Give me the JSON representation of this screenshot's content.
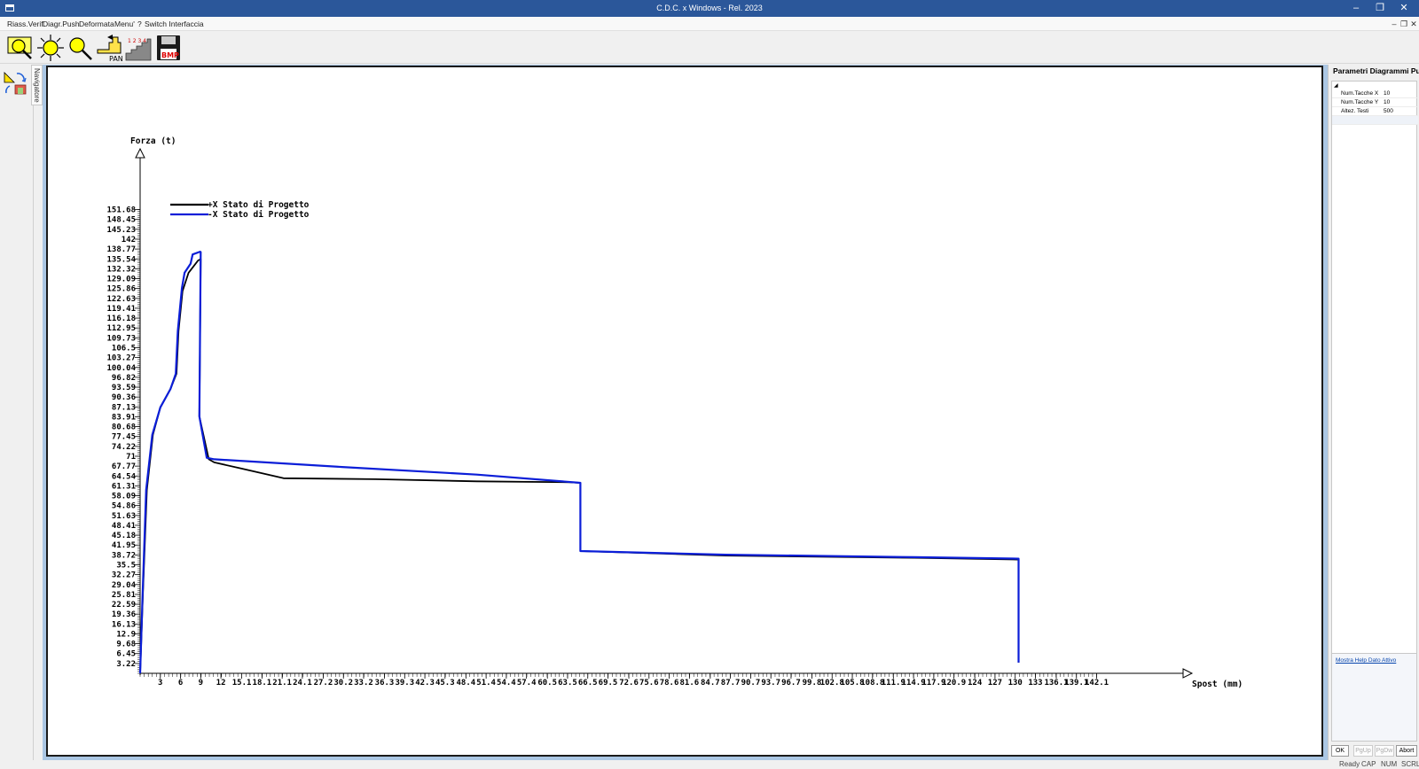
{
  "window": {
    "title": "C.D.C. x Windows - Rel. 2023"
  },
  "menu": {
    "items": [
      "Riass.Verif.",
      "Diagr.Push",
      "Deformata",
      "Menu'",
      "?",
      "Switch Interfaccia"
    ]
  },
  "toolbar": {
    "pan_label": "PAN",
    "bmp_label": "BMP"
  },
  "navigator": {
    "tab_label": "Navigatore"
  },
  "right_panel": {
    "title": "Parametri Diagrammi Pu...",
    "properties": [
      {
        "name": "Num.Tacche X",
        "value": "10"
      },
      {
        "name": "Num.Tacche Y",
        "value": "10"
      },
      {
        "name": "Altez. Testi",
        "value": "500"
      }
    ],
    "help_link": "Mostra Help Dato Attivo",
    "buttons": {
      "ok": "OK",
      "pgup": "PgUp",
      "pgdw": "PgDw",
      "abort": "Abort"
    }
  },
  "status": {
    "ready": "Ready",
    "cap": "CAP",
    "num": "NUM",
    "scrl": "SCRL"
  },
  "chart_data": {
    "type": "line",
    "ylabel": "Forza (t)",
    "xlabel": "Spost (mm)",
    "y_ticks": [
      "3.22",
      "6.45",
      "9.68",
      "12.9",
      "16.13",
      "19.36",
      "22.59",
      "25.81",
      "29.04",
      "32.27",
      "35.5",
      "38.72",
      "41.95",
      "45.18",
      "48.41",
      "51.63",
      "54.86",
      "58.09",
      "61.31",
      "64.54",
      "67.77",
      "71",
      "74.22",
      "77.45",
      "80.68",
      "83.91",
      "87.13",
      "90.36",
      "93.59",
      "96.82",
      "100.04",
      "103.27",
      "106.5",
      "109.73",
      "112.95",
      "116.18",
      "119.41",
      "122.63",
      "125.86",
      "129.09",
      "132.32",
      "135.54",
      "138.77",
      "142",
      "145.23",
      "148.45",
      "151.68"
    ],
    "x_ticks": [
      "3",
      "6",
      "9",
      "12",
      "15.1",
      "18.1",
      "21.1",
      "24.1",
      "27.2",
      "30.2",
      "33.2",
      "36.3",
      "39.3",
      "42.3",
      "45.3",
      "48.4",
      "51.4",
      "54.4",
      "57.4",
      "60.5",
      "63.5",
      "66.5",
      "69.5",
      "72.6",
      "75.6",
      "78.6",
      "81.6",
      "84.7",
      "87.7",
      "90.7",
      "93.7",
      "96.7",
      "99.8",
      "102.8",
      "105.8",
      "108.8",
      "111.9",
      "114.9",
      "117.9",
      "120.9",
      "124",
      "127",
      "130",
      "133",
      "136.1",
      "139.1",
      "142.1"
    ],
    "y_range": [
      0,
      151.68
    ],
    "x_range": [
      0,
      142.1
    ],
    "grid": false,
    "legend_position": "top-left",
    "series": [
      {
        "name": "+X Stato di Progetto",
        "color": "#000000",
        "points": [
          [
            0,
            0
          ],
          [
            0.4,
            25
          ],
          [
            1,
            60
          ],
          [
            1.9,
            78
          ],
          [
            3,
            87
          ],
          [
            4.5,
            93
          ],
          [
            5.4,
            98
          ],
          [
            5.7,
            112
          ],
          [
            6.3,
            125
          ],
          [
            7.2,
            131
          ],
          [
            8.6,
            135
          ],
          [
            9,
            135.5
          ],
          [
            9,
            135
          ],
          [
            8.8,
            84
          ],
          [
            10.2,
            70
          ],
          [
            11,
            69
          ],
          [
            15,
            67
          ],
          [
            21.3,
            63.8
          ],
          [
            35,
            63.5
          ],
          [
            50,
            62.8
          ],
          [
            63.8,
            62.5
          ],
          [
            65.4,
            62.3
          ],
          [
            65.4,
            40
          ],
          [
            87,
            38.5
          ],
          [
            115,
            37.8
          ],
          [
            130.5,
            37.2
          ],
          [
            130.5,
            3.5
          ]
        ]
      },
      {
        "name": "-X Stato di Progetto",
        "color": "#0b1ed8",
        "points": [
          [
            0,
            0
          ],
          [
            0.35,
            25
          ],
          [
            0.9,
            60
          ],
          [
            1.8,
            78
          ],
          [
            3,
            87
          ],
          [
            4.5,
            93
          ],
          [
            5.3,
            98
          ],
          [
            5.6,
            112
          ],
          [
            6.2,
            126
          ],
          [
            6.6,
            131
          ],
          [
            7.5,
            134
          ],
          [
            7.8,
            137
          ],
          [
            8.9,
            137.9
          ],
          [
            9,
            137.8
          ],
          [
            8.8,
            84
          ],
          [
            9.9,
            70.5
          ],
          [
            11,
            70
          ],
          [
            30,
            67.5
          ],
          [
            50,
            65
          ],
          [
            65.4,
            62.3
          ],
          [
            65.4,
            40
          ],
          [
            87,
            38.8
          ],
          [
            115,
            38
          ],
          [
            130.5,
            37.5
          ],
          [
            130.5,
            3.5
          ]
        ]
      }
    ]
  }
}
